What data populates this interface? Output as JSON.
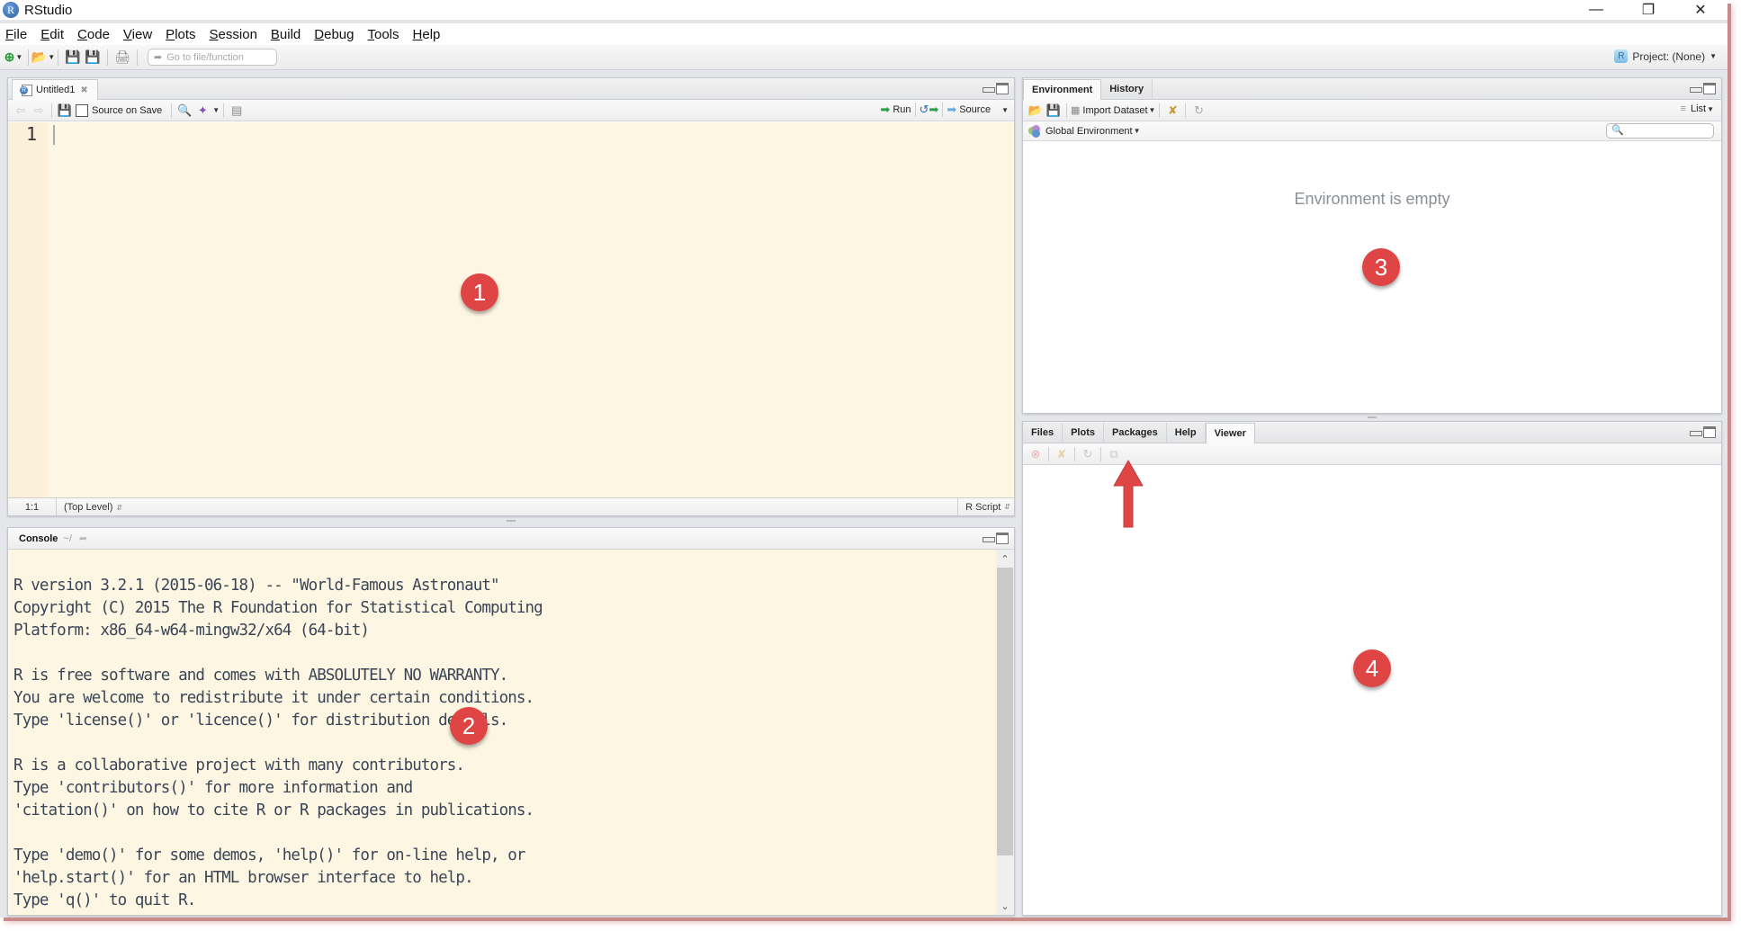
{
  "window": {
    "title": "RStudio",
    "controls": [
      "minimize",
      "restore",
      "close"
    ]
  },
  "menu": [
    "File",
    "Edit",
    "Code",
    "View",
    "Plots",
    "Session",
    "Build",
    "Debug",
    "Tools",
    "Help"
  ],
  "toolbar": {
    "goto_placeholder": "Go to file/function",
    "project_label": "Project: (None)"
  },
  "source": {
    "tab_label": "Untitled1",
    "source_on_save_label": "Source on Save",
    "run_label": "Run",
    "source_label": "Source",
    "line_number": "1",
    "cursor_position": "1:1",
    "scope": "(Top Level)",
    "file_type": "R Script"
  },
  "console": {
    "title": "Console",
    "path": "~/",
    "lines": [
      "R version 3.2.1 (2015-06-18) -- \"World-Famous Astronaut\"",
      "Copyright (C) 2015 The R Foundation for Statistical Computing",
      "Platform: x86_64-w64-mingw32/x64 (64-bit)",
      "",
      "R is free software and comes with ABSOLUTELY NO WARRANTY.",
      "You are welcome to redistribute it under certain conditions.",
      "Type 'license()' or 'licence()' for distribution details.",
      "",
      "R is a collaborative project with many contributors.",
      "Type 'contributors()' for more information and",
      "'citation()' on how to cite R or R packages in publications.",
      "",
      "Type 'demo()' for some demos, 'help()' for on-line help, or",
      "'help.start()' for an HTML browser interface to help.",
      "Type 'q()' to quit R."
    ]
  },
  "environment": {
    "tabs": [
      "Environment",
      "History"
    ],
    "active_tab": "Environment",
    "import_label": "Import Dataset",
    "view_mode": "List",
    "scope_label": "Global Environment",
    "search_placeholder": "",
    "empty_message": "Environment is empty"
  },
  "files": {
    "tabs": [
      "Files",
      "Plots",
      "Packages",
      "Help",
      "Viewer"
    ],
    "active_tab": "Viewer"
  },
  "annotations": {
    "badges": [
      "1",
      "2",
      "3",
      "4"
    ],
    "badge_color": "#e04545",
    "arrow_color": "#e04545"
  }
}
